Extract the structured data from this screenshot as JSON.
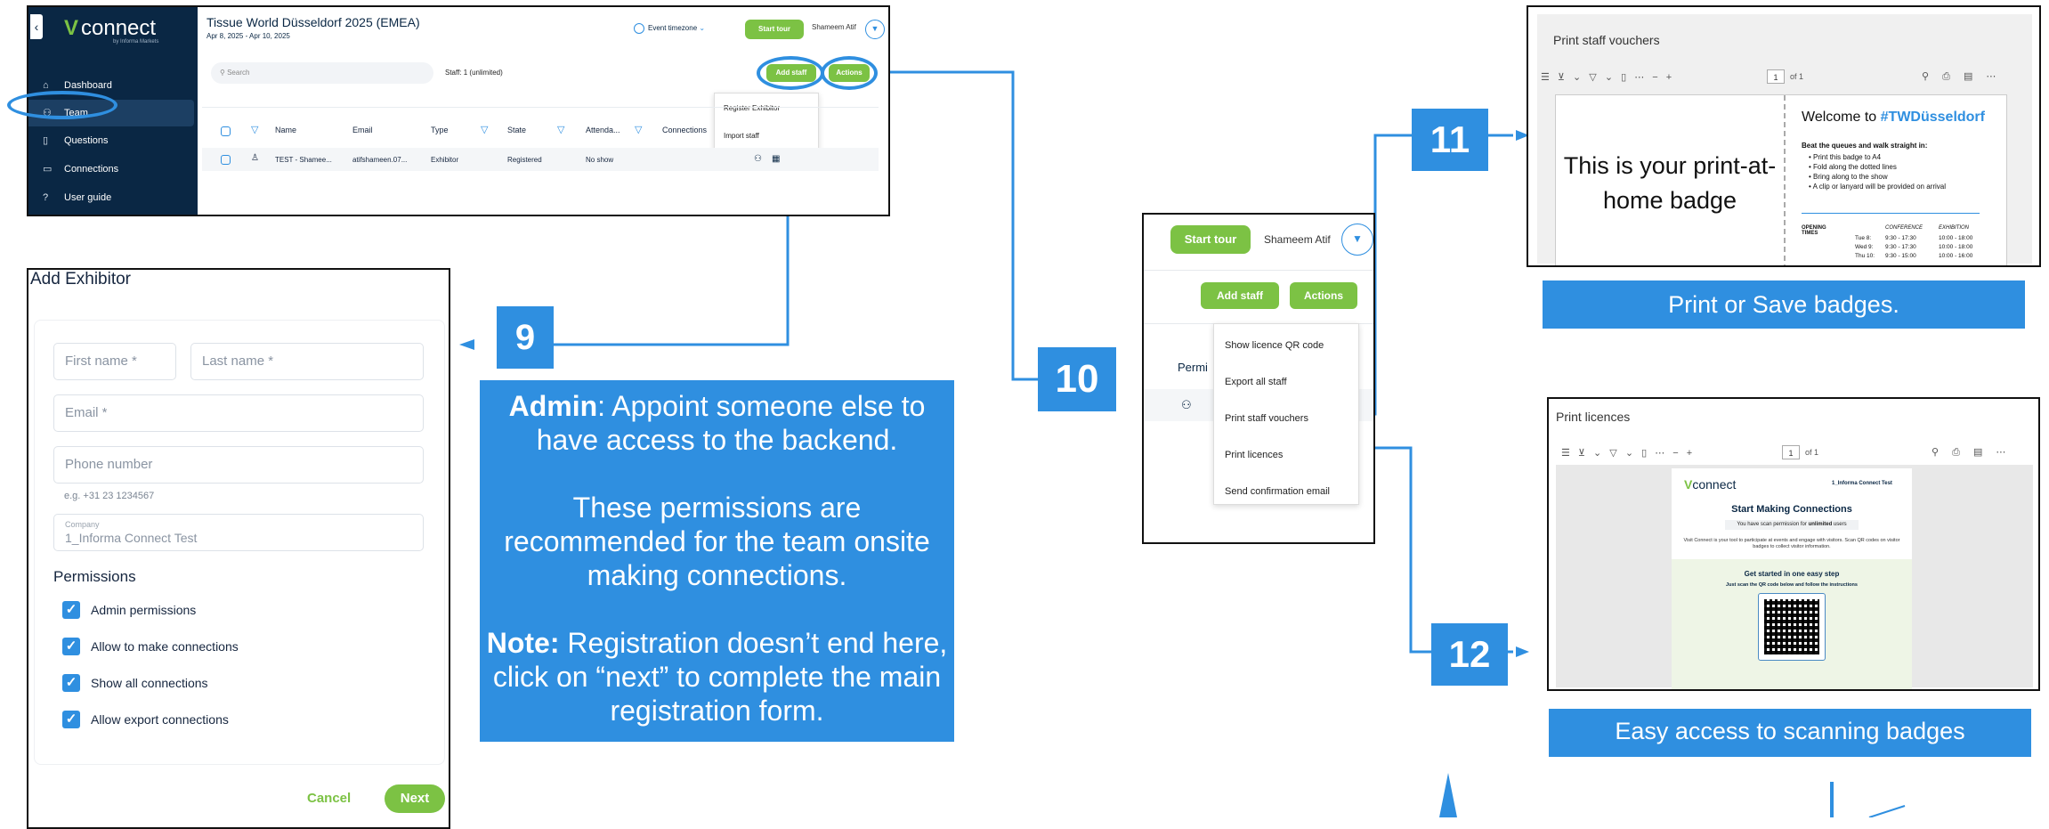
{
  "app": {
    "logo_text": "connect",
    "logo_sub": "by Informa Markets",
    "event_title": "Tissue World Düsseldorf 2025 (EMEA)",
    "event_dates": "Apr 8, 2025 - Apr 10, 2025",
    "timezone_label": "Event timezone",
    "start_tour": "Start tour",
    "user_name": "Shameem Atif",
    "nav": [
      {
        "label": "Dashboard",
        "icon": "home-icon"
      },
      {
        "label": "Team",
        "icon": "team-icon"
      },
      {
        "label": "Questions",
        "icon": "clipboard-icon"
      },
      {
        "label": "Connections",
        "icon": "contact-card-icon"
      },
      {
        "label": "User guide",
        "icon": "help-icon"
      }
    ],
    "search_placeholder": "Search",
    "staff_count": "Staff: 1 (unlimited)",
    "add_staff": "Add staff",
    "actions": "Actions",
    "actions_menu_small": [
      "Register Exhibitor",
      "Import staff"
    ],
    "table": {
      "headers": [
        "Name",
        "Email",
        "Type",
        "State",
        "Attenda...",
        "Connections"
      ],
      "row": [
        "TEST - Shamee...",
        "atifshameen.07...",
        "Exhibitor",
        "Registered",
        "No show"
      ]
    }
  },
  "add_exhibitor": {
    "title": "Add Exhibitor",
    "first_name": "First name *",
    "last_name": "Last name *",
    "email": "Email *",
    "phone": "Phone number",
    "phone_hint": "e.g. +31 23 1234567",
    "company_label": "Company",
    "company_value": "1_Informa Connect Test",
    "permissions_title": "Permissions",
    "permissions": [
      "Admin permissions",
      "Allow to make connections",
      "Show all connections",
      "Allow export connections"
    ],
    "cancel": "Cancel",
    "next": "Next"
  },
  "steps": {
    "s9": "9",
    "s10": "10",
    "s11": "11",
    "s12": "12"
  },
  "info": {
    "admin_bold": "Admin",
    "admin_text": ": Appoint someone else to have access to the backend.",
    "perm_text": "These permissions are recommended for the team onsite making connections.",
    "note_bold": "Note:",
    "note_text": " Registration doesn’t end here, click on “next” to complete the main registration form."
  },
  "zoom": {
    "start_tour": "Start tour",
    "user_name": "Shameem Atif",
    "add_staff": "Add staff",
    "actions": "Actions",
    "partial_label": "Permi",
    "menu": [
      "Show licence QR code",
      "Export all staff",
      "Print staff vouchers",
      "Print licences",
      "Send confirmation email"
    ]
  },
  "vouchers": {
    "title": "Print staff vouchers",
    "page_num": "1",
    "page_of": "of 1",
    "badge_text": "This is your print-at-home badge",
    "welcome": "Welcome to",
    "hashtag": "#TWDüsseldorf",
    "beat": "Beat the queues and walk straight in:",
    "bullets": [
      "Print this badge to A4",
      "Fold along the dotted lines",
      "Bring along to the show",
      "A clip or lanyard will be provided on arrival"
    ],
    "opening": "OPENING TIMES",
    "col_conf": "CONFERENCE",
    "col_exh": "EXHIBITION",
    "times": [
      [
        "Tue 8:",
        "9:30 - 17:30",
        "10:00 - 18:00"
      ],
      [
        "Wed 9:",
        "9:30 - 17:30",
        "10:00 - 18:00"
      ],
      [
        "Thu 10:",
        "9:30 - 15:00",
        "10:00 - 16:00"
      ]
    ],
    "caption": "Print or Save badges."
  },
  "licences": {
    "title": "Print licences",
    "page_num": "1",
    "page_of": "of 1",
    "heading": "Start Making Connections",
    "scan_pre": "You have scan permission for",
    "scan_bold": "unlimited",
    "scan_post": "users",
    "desc": "Visit Connect is your tool to participate at events and engage with visitors. Scan QR codes on visitor badges to collect visitor information.",
    "get_started": "Get started in one easy step",
    "just_scan": "Just scan the QR code below and follow the instructions",
    "licence_name": "1_Informa Connect Test",
    "caption": "Easy access to scanning badges"
  },
  "colors": {
    "accent": "#2f8fe0",
    "green": "#7cc244",
    "navy": "#0a2744"
  }
}
